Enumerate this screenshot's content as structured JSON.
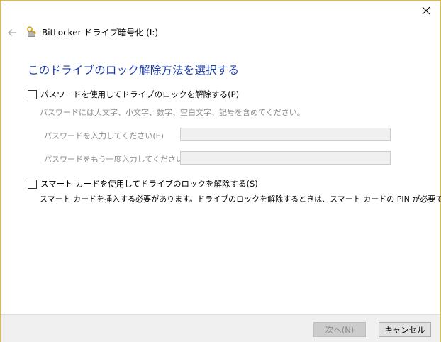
{
  "window": {
    "title": "BitLocker ドライブ暗号化 (I:)"
  },
  "heading": "このドライブのロック解除方法を選択する",
  "password_option": {
    "label": "パスワードを使用してドライブのロックを解除する(P)",
    "checked": false,
    "hint": "パスワードには大文字、小文字、数字、空白文字、記号を含めてください。",
    "fields": [
      {
        "label": "パスワードを入力してください(E)",
        "value": ""
      },
      {
        "label": "パスワードをもう一度入力してください(R)",
        "value": ""
      }
    ]
  },
  "smartcard_option": {
    "label": "スマート カードを使用してドライブのロックを解除する(S)",
    "checked": false,
    "description": "スマート カードを挿入する必要があります。ドライブのロックを解除するときは、スマート カードの PIN が必要です。"
  },
  "buttons": {
    "next": "次へ(N)",
    "cancel": "キャンセル"
  },
  "colors": {
    "heading": "#1f3ea8",
    "window_border": "#e8bd22",
    "footer_bg": "#f0f0f0"
  },
  "icons": {
    "back": "back-arrow-icon",
    "app": "bitlocker-key-icon",
    "close": "close-icon"
  }
}
